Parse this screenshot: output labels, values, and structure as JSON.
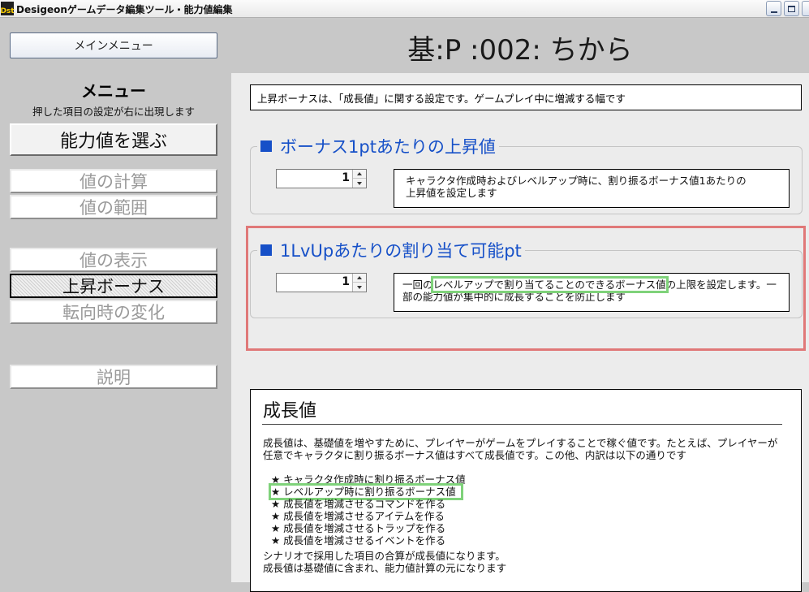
{
  "window": {
    "title": "Desigeonゲームデータ編集ツール・能力値編集",
    "icon_label": "Dst"
  },
  "sidebar": {
    "main_menu_label": "メインメニュー",
    "heading": "メニュー",
    "subheading": "押した項目の設定が右に出現します",
    "items": {
      "select": "能力値を選ぶ",
      "calc": "値の計算",
      "range": "値の範囲",
      "display": "値の表示",
      "bonus": "上昇ボーナス",
      "turn": "転向時の変化",
      "help": "説明"
    },
    "active_item": "bonus"
  },
  "header": {
    "page_title": "基:P :002: ちから"
  },
  "intro": "上昇ボーナスは、「成長値」に関する設定です。ゲームプレイ中に増減する幅です",
  "bonus_per_pt": {
    "legend": "ボーナス1ptあたりの上昇値",
    "value": "1",
    "description_line1": "キャラクタ作成時およびレベルアップ時に、割り振るボーナス値1あたりの",
    "description_line2": "上昇値を設定します"
  },
  "per_levelup": {
    "legend": "1LvUpあたりの割り当て可能pt",
    "value": "1",
    "description_pre": "一回の",
    "description_highlight": "レベルアップで割り当てることのできるボーナス値",
    "description_post": "の上限を設定します。一部の能力値が集中的に成長することを防止します"
  },
  "growth": {
    "title": "成長値",
    "body": "成長値は、基礎値を増やすために、プレイヤーがゲームをプレイすることで稼ぐ値です。たとえば、プレイヤーが任意でキャラクタに割り振るボーナス値はすべて成長値です。この他、内訳は以下の通りです",
    "bullets": [
      "★ キャラクタ作成時に割り振るボーナス値",
      "★ レベルアップ時に割り振るボーナス値",
      "★ 成長値を増減させるコマンドを作る",
      "★ 成長値を増減させるアイテムを作る",
      "★ 成長値を増減させるトラップを作る",
      "★ 成長値を増減させるイベントを作る"
    ],
    "footer_line1": "シナリオで採用した項目の合算が成長値になります。",
    "footer_line2": "成長値は基礎値に含まれ、能力値計算の元になります"
  },
  "colors": {
    "legend_blue": "#1650c8",
    "highlight_green": "#7fd27a",
    "frame_red": "#e07878"
  }
}
